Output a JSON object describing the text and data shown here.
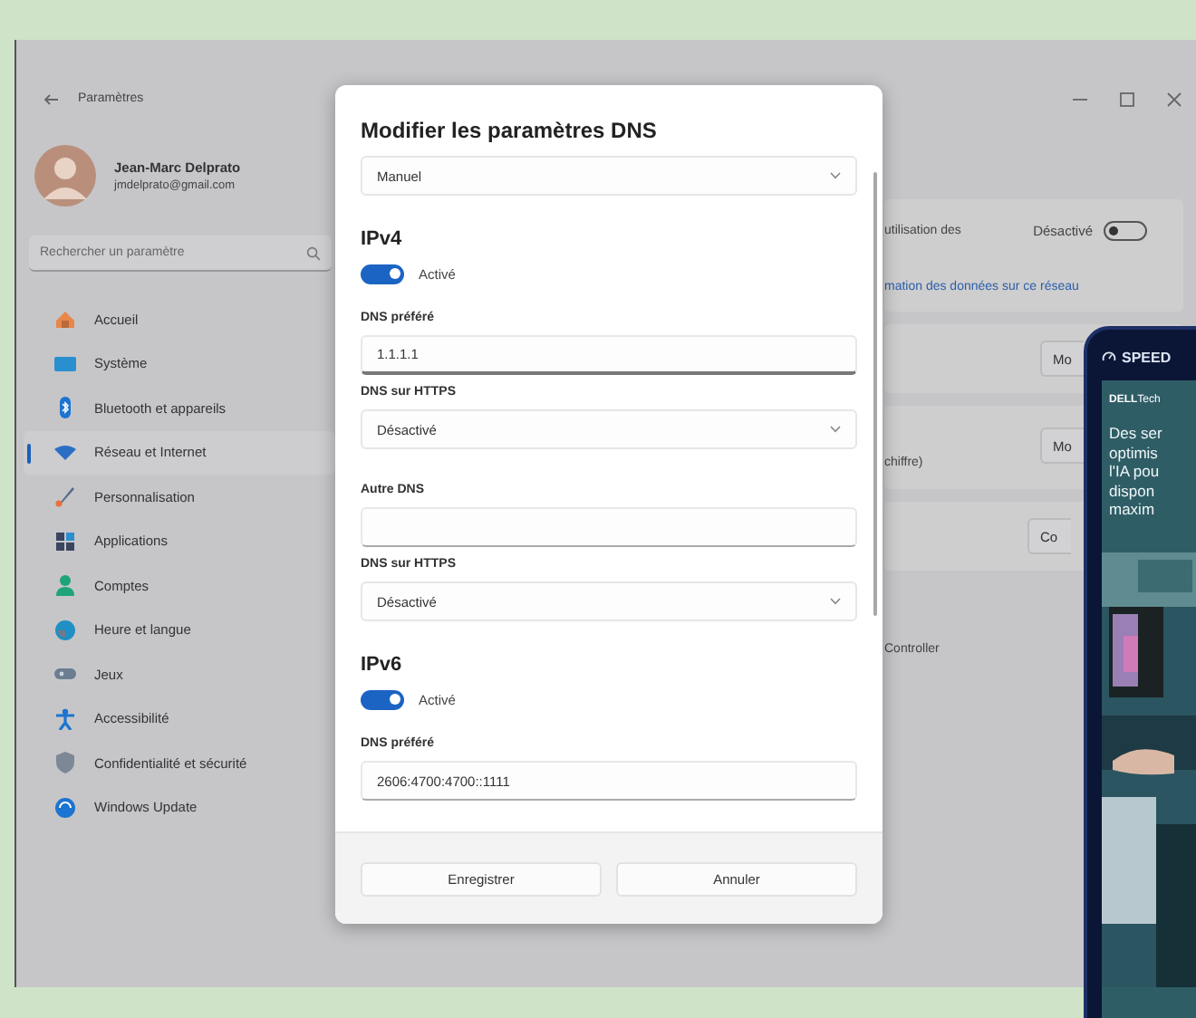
{
  "window": {
    "title": "Paramètres"
  },
  "profile": {
    "name": "Jean-Marc Delprato",
    "email": "jmdelprato@gmail.com"
  },
  "search": {
    "placeholder": "Rechercher un paramètre"
  },
  "sidebar": {
    "items": [
      {
        "label": "Accueil",
        "selected": false
      },
      {
        "label": "Système",
        "selected": false
      },
      {
        "label": "Bluetooth et appareils",
        "selected": false
      },
      {
        "label": "Réseau et Internet",
        "selected": true
      },
      {
        "label": "Personnalisation",
        "selected": false
      },
      {
        "label": "Applications",
        "selected": false
      },
      {
        "label": "Comptes",
        "selected": false
      },
      {
        "label": "Heure et langue",
        "selected": false
      },
      {
        "label": "Jeux",
        "selected": false
      },
      {
        "label": "Accessibilité",
        "selected": false
      },
      {
        "label": "Confidentialité et sécurité",
        "selected": false
      },
      {
        "label": "Windows Update",
        "selected": false
      }
    ]
  },
  "main": {
    "cards": [
      {
        "rows": [
          {
            "kind": "toggle",
            "label": "utilisation des",
            "value": "Désactivé",
            "on": false
          },
          {
            "kind": "link",
            "label": "mation des données sur ce réseau"
          }
        ]
      },
      {
        "rows": [
          {
            "kind": "button",
            "button": "Mo"
          }
        ]
      },
      {
        "rows": [
          {
            "kind": "button_text",
            "label": "chiffre)",
            "button": "Mo"
          }
        ]
      },
      {
        "rows": [
          {
            "kind": "button",
            "button": "Co"
          }
        ]
      }
    ],
    "footer_text": "Controller"
  },
  "dialog": {
    "title": "Modifier les paramètres DNS",
    "items": [
      {
        "kind": "dropdown",
        "value": "Manuel"
      },
      {
        "kind": "heading",
        "text": "IPv4"
      },
      {
        "kind": "toggle",
        "text": "Activé",
        "on": true
      },
      {
        "kind": "label",
        "text": "DNS préféré"
      },
      {
        "kind": "field",
        "value": "1.1.1.1",
        "focused": true
      },
      {
        "kind": "label",
        "text": "DNS sur HTTPS"
      },
      {
        "kind": "dropdown",
        "value": "Désactivé"
      },
      {
        "kind": "label",
        "text": "Autre DNS"
      },
      {
        "kind": "field",
        "value": "",
        "focused": false
      },
      {
        "kind": "label",
        "text": "DNS sur HTTPS"
      },
      {
        "kind": "dropdown",
        "value": "Désactivé"
      },
      {
        "kind": "heading",
        "text": "IPv6"
      },
      {
        "kind": "toggle",
        "text": "Activé",
        "on": true
      },
      {
        "kind": "label",
        "text": "DNS préféré"
      },
      {
        "kind": "field",
        "value": "2606:4700:4700::1111",
        "focused": false
      }
    ],
    "buttons": [
      "Enregistrer",
      "Annuler"
    ]
  },
  "tablet": {
    "header": "SPEED",
    "brand": "**DELL**Tech",
    "lines": [
      "Des ser",
      "optimis",
      "l'IA pou",
      "dispon",
      "maxim"
    ]
  }
}
